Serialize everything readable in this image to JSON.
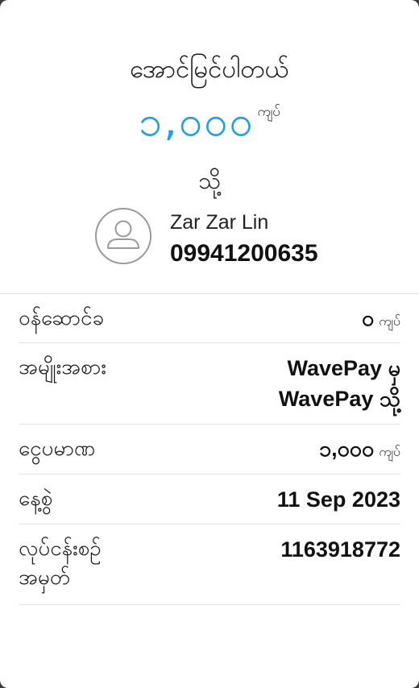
{
  "header": {
    "title": "အောင်မြင်ပါတယ်",
    "amount": "၁,၀၀၀",
    "amount_unit": "ကျပ်",
    "to_label": "သို့"
  },
  "recipient": {
    "name": "Zar Zar Lin",
    "phone": "09941200635",
    "avatar_icon": "user-avatar-icon"
  },
  "details": {
    "fee": {
      "label": "ဝန်ဆောင်ခ",
      "value": "၀",
      "unit": "ကျပ်"
    },
    "type": {
      "label": "အမျိုးအစား",
      "value_line1": "WavePay မှ",
      "value_line2": "WavePay သို့"
    },
    "amount": {
      "label": "ငွေပမာဏ",
      "value": "၁,၀၀၀",
      "unit": "ကျပ်"
    },
    "date": {
      "label": "နေ့စွဲ",
      "value": "11 Sep 2023"
    },
    "txn_id": {
      "label_line1": "လုပ်ငန်းစဉ်",
      "label_line2": "အမှတ်",
      "value": "1163918772"
    }
  },
  "colors": {
    "accent": "#1aa3e0",
    "background": "#ffffff",
    "divider": "#e4e4e4"
  }
}
